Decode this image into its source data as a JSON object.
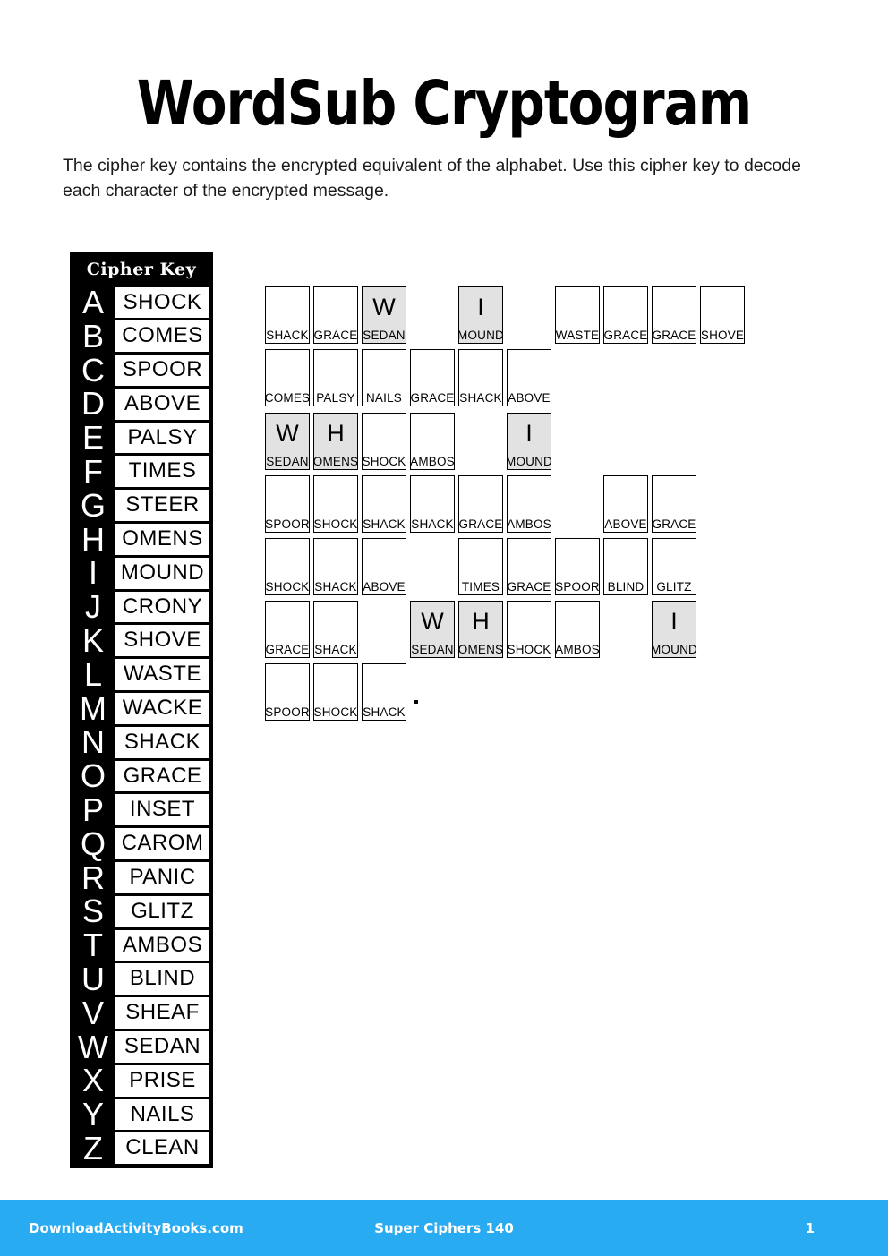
{
  "header": {
    "title": "WordSub Cryptogram",
    "instructions": "The cipher key contains the encrypted equivalent of the alphabet. Use this cipher key to decode each character of the encrypted message."
  },
  "cipher_key": {
    "header_label": "Cipher Key",
    "entries": [
      {
        "letter": "A",
        "word": "SHOCK"
      },
      {
        "letter": "B",
        "word": "COMES"
      },
      {
        "letter": "C",
        "word": "SPOOR"
      },
      {
        "letter": "D",
        "word": "ABOVE"
      },
      {
        "letter": "E",
        "word": "PALSY"
      },
      {
        "letter": "F",
        "word": "TIMES"
      },
      {
        "letter": "G",
        "word": "STEER"
      },
      {
        "letter": "H",
        "word": "OMENS"
      },
      {
        "letter": "I",
        "word": "MOUND"
      },
      {
        "letter": "J",
        "word": "CRONY"
      },
      {
        "letter": "K",
        "word": "SHOVE"
      },
      {
        "letter": "L",
        "word": "WASTE"
      },
      {
        "letter": "M",
        "word": "WACKE"
      },
      {
        "letter": "N",
        "word": "SHACK"
      },
      {
        "letter": "O",
        "word": "GRACE"
      },
      {
        "letter": "P",
        "word": "INSET"
      },
      {
        "letter": "Q",
        "word": "CAROM"
      },
      {
        "letter": "R",
        "word": "PANIC"
      },
      {
        "letter": "S",
        "word": "GLITZ"
      },
      {
        "letter": "T",
        "word": "AMBOS"
      },
      {
        "letter": "U",
        "word": "BLIND"
      },
      {
        "letter": "V",
        "word": "SHEAF"
      },
      {
        "letter": "W",
        "word": "SEDAN"
      },
      {
        "letter": "X",
        "word": "PRISE"
      },
      {
        "letter": "Y",
        "word": "NAILS"
      },
      {
        "letter": "Z",
        "word": "CLEAN"
      }
    ]
  },
  "puzzle": {
    "rows": [
      [
        {
          "type": "cell",
          "clue": "SHACK",
          "answer": "",
          "shaded": false
        },
        {
          "type": "cell",
          "clue": "GRACE",
          "answer": "",
          "shaded": false
        },
        {
          "type": "cell",
          "clue": "SEDAN",
          "answer": "W",
          "shaded": true
        },
        {
          "type": "gap"
        },
        {
          "type": "cell",
          "clue": "MOUND",
          "answer": "I",
          "shaded": true
        },
        {
          "type": "gap"
        },
        {
          "type": "cell",
          "clue": "WASTE",
          "answer": "",
          "shaded": false
        },
        {
          "type": "cell",
          "clue": "GRACE",
          "answer": "",
          "shaded": false
        },
        {
          "type": "cell",
          "clue": "GRACE",
          "answer": "",
          "shaded": false
        },
        {
          "type": "cell",
          "clue": "SHOVE",
          "answer": "",
          "shaded": false
        }
      ],
      [
        {
          "type": "cell",
          "clue": "COMES",
          "answer": "",
          "shaded": false
        },
        {
          "type": "cell",
          "clue": "PALSY",
          "answer": "",
          "shaded": false
        },
        {
          "type": "cell",
          "clue": "NAILS",
          "answer": "",
          "shaded": false
        },
        {
          "type": "cell",
          "clue": "GRACE",
          "answer": "",
          "shaded": false
        },
        {
          "type": "cell",
          "clue": "SHACK",
          "answer": "",
          "shaded": false
        },
        {
          "type": "cell",
          "clue": "ABOVE",
          "answer": "",
          "shaded": false
        }
      ],
      [
        {
          "type": "cell",
          "clue": "SEDAN",
          "answer": "W",
          "shaded": true
        },
        {
          "type": "cell",
          "clue": "OMENS",
          "answer": "H",
          "shaded": true
        },
        {
          "type": "cell",
          "clue": "SHOCK",
          "answer": "",
          "shaded": false
        },
        {
          "type": "cell",
          "clue": "AMBOS",
          "answer": "",
          "shaded": false
        },
        {
          "type": "gap"
        },
        {
          "type": "cell",
          "clue": "MOUND",
          "answer": "I",
          "shaded": true
        }
      ],
      [
        {
          "type": "cell",
          "clue": "SPOOR",
          "answer": "",
          "shaded": false
        },
        {
          "type": "cell",
          "clue": "SHOCK",
          "answer": "",
          "shaded": false
        },
        {
          "type": "cell",
          "clue": "SHACK",
          "answer": "",
          "shaded": false
        },
        {
          "type": "cell",
          "clue": "SHACK",
          "answer": "",
          "shaded": false
        },
        {
          "type": "cell",
          "clue": "GRACE",
          "answer": "",
          "shaded": false
        },
        {
          "type": "cell",
          "clue": "AMBOS",
          "answer": "",
          "shaded": false
        },
        {
          "type": "gap"
        },
        {
          "type": "cell",
          "clue": "ABOVE",
          "answer": "",
          "shaded": false
        },
        {
          "type": "cell",
          "clue": "GRACE",
          "answer": "",
          "shaded": false
        }
      ],
      [
        {
          "type": "cell",
          "clue": "SHOCK",
          "answer": "",
          "shaded": false
        },
        {
          "type": "cell",
          "clue": "SHACK",
          "answer": "",
          "shaded": false
        },
        {
          "type": "cell",
          "clue": "ABOVE",
          "answer": "",
          "shaded": false
        },
        {
          "type": "gap"
        },
        {
          "type": "cell",
          "clue": "TIMES",
          "answer": "",
          "shaded": false
        },
        {
          "type": "cell",
          "clue": "GRACE",
          "answer": "",
          "shaded": false
        },
        {
          "type": "cell",
          "clue": "SPOOR",
          "answer": "",
          "shaded": false
        },
        {
          "type": "cell",
          "clue": "BLIND",
          "answer": "",
          "shaded": false
        },
        {
          "type": "cell",
          "clue": "GLITZ",
          "answer": "",
          "shaded": false
        }
      ],
      [
        {
          "type": "cell",
          "clue": "GRACE",
          "answer": "",
          "shaded": false
        },
        {
          "type": "cell",
          "clue": "SHACK",
          "answer": "",
          "shaded": false
        },
        {
          "type": "gap"
        },
        {
          "type": "cell",
          "clue": "SEDAN",
          "answer": "W",
          "shaded": true
        },
        {
          "type": "cell",
          "clue": "OMENS",
          "answer": "H",
          "shaded": true
        },
        {
          "type": "cell",
          "clue": "SHOCK",
          "answer": "",
          "shaded": false
        },
        {
          "type": "cell",
          "clue": "AMBOS",
          "answer": "",
          "shaded": false
        },
        {
          "type": "gap"
        },
        {
          "type": "cell",
          "clue": "MOUND",
          "answer": "I",
          "shaded": true
        }
      ],
      [
        {
          "type": "cell",
          "clue": "SPOOR",
          "answer": "",
          "shaded": false
        },
        {
          "type": "cell",
          "clue": "SHOCK",
          "answer": "",
          "shaded": false
        },
        {
          "type": "cell",
          "clue": "SHACK",
          "answer": "",
          "shaded": false
        },
        {
          "type": "period"
        }
      ]
    ]
  },
  "footer": {
    "site": "DownloadActivityBooks.com",
    "book": "Super Ciphers 140",
    "page": "1",
    "background_color": "#29abf2"
  }
}
